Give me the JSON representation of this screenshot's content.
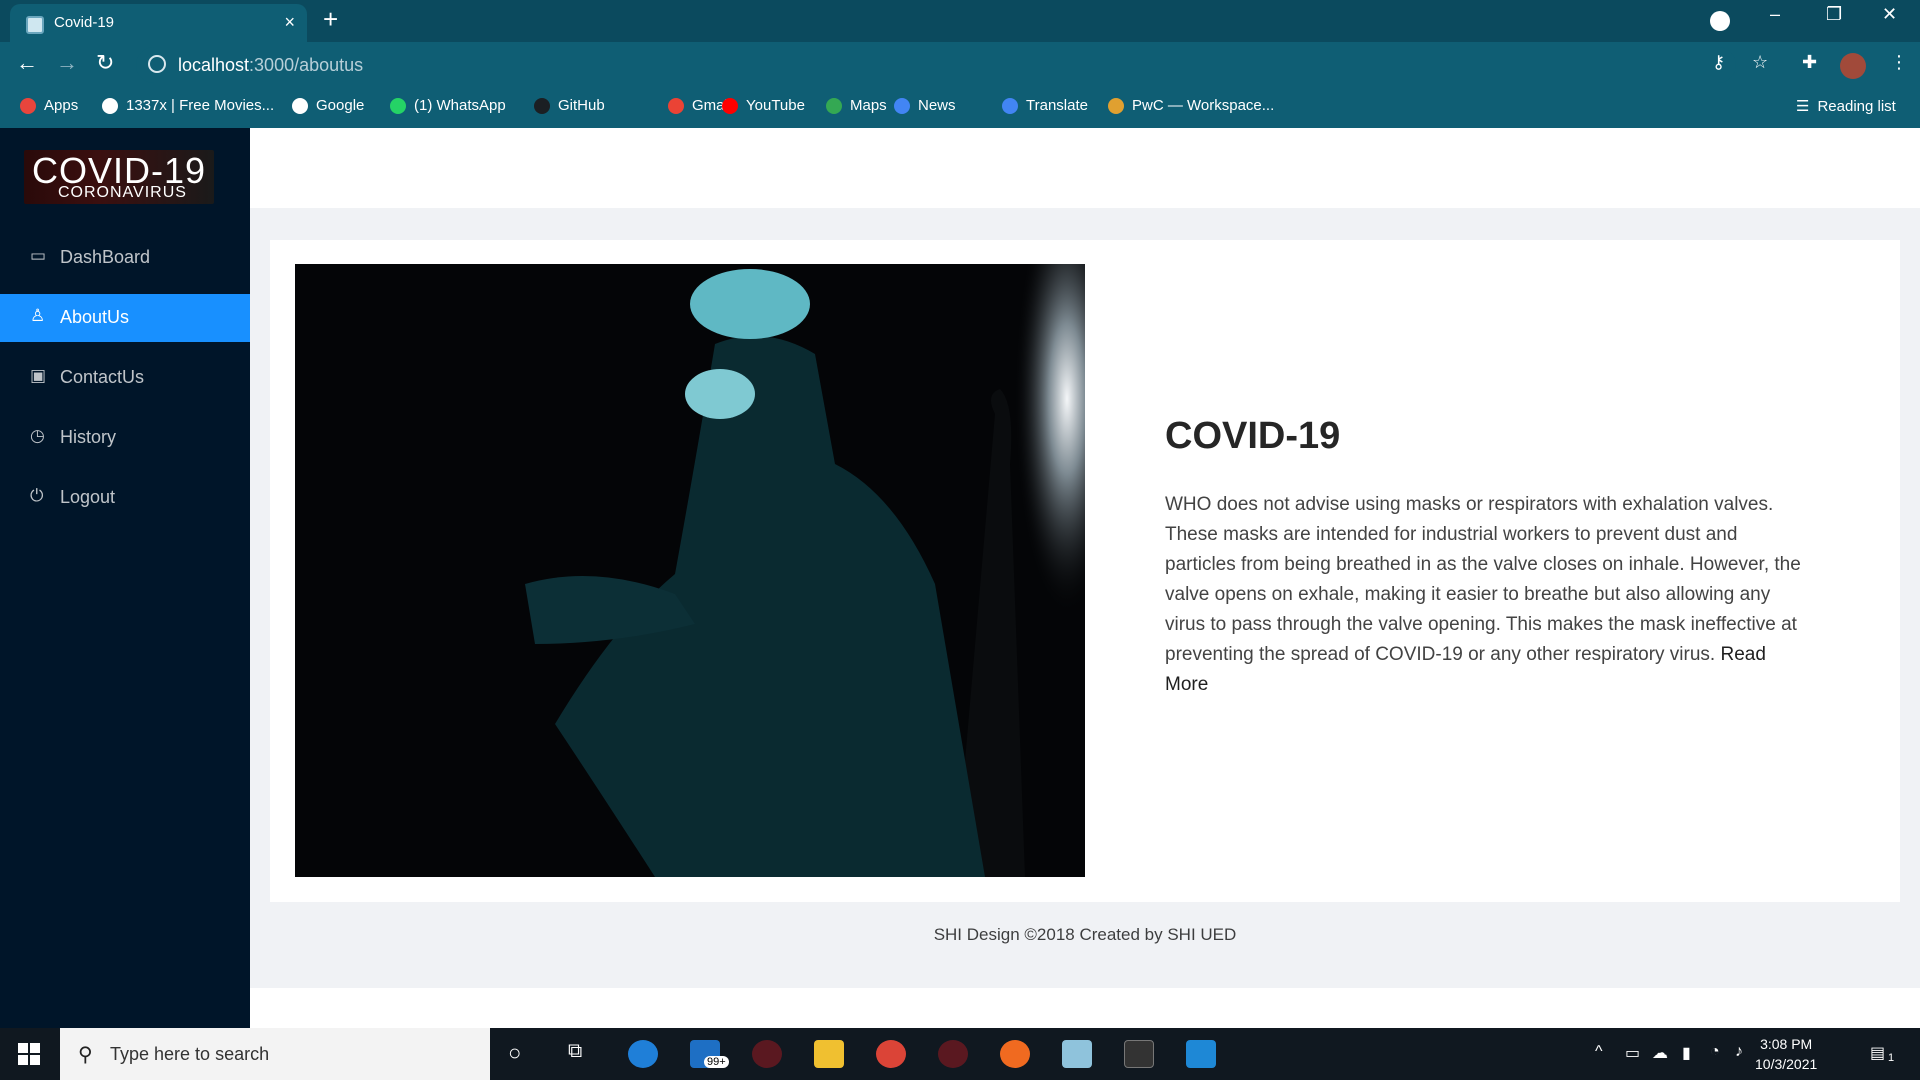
{
  "browser": {
    "tab_title": "Covid-19",
    "tab_close": "×",
    "new_tab": "+",
    "url_host": "localhost",
    "url_path": ":3000/aboutus",
    "window_controls": {
      "minimize": "–",
      "restore": "❐",
      "close": "✕"
    },
    "bookmarks": [
      {
        "label": "Apps",
        "icon": "apps-grid-icon",
        "color": "#e8453c"
      },
      {
        "label": "1337x | Free Movies...",
        "icon": "1337x-icon",
        "color": "#ffffff"
      },
      {
        "label": "Google",
        "icon": "google-icon",
        "color": "#ffffff"
      },
      {
        "label": "(1) WhatsApp",
        "icon": "whatsapp-icon",
        "color": "#25d366"
      },
      {
        "label": "GitHub",
        "icon": "github-icon",
        "color": "#1b1f23"
      },
      {
        "label": "Gmail",
        "icon": "gmail-icon",
        "color": "#ea4335"
      },
      {
        "label": "YouTube",
        "icon": "youtube-icon",
        "color": "#ff0000"
      },
      {
        "label": "Maps",
        "icon": "maps-icon",
        "color": "#34a853"
      },
      {
        "label": "News",
        "icon": "news-icon",
        "color": "#4285f4"
      },
      {
        "label": "Translate",
        "icon": "translate-icon",
        "color": "#4285f4"
      },
      {
        "label": "PwC — Workspace...",
        "icon": "pwc-icon",
        "color": "#e0a030"
      }
    ],
    "reading_list": "Reading list"
  },
  "sidebar": {
    "logo_title": "COVID-19",
    "logo_subtitle": "CORONAVIRUS",
    "items": [
      {
        "label": "DashBoard",
        "icon": "desktop-icon",
        "active": false
      },
      {
        "label": "AboutUs",
        "icon": "user-icon",
        "active": true
      },
      {
        "label": "ContactUs",
        "icon": "contacts-icon",
        "active": false
      },
      {
        "label": "History",
        "icon": "history-icon",
        "active": false
      },
      {
        "label": "Logout",
        "icon": "logout-icon",
        "active": false
      }
    ]
  },
  "main": {
    "title": "COVID-19",
    "body": "WHO does not advise using masks or respirators with exhalation valves. These masks are intended for industrial workers to prevent dust and particles from being breathed in as the valve closes on inhale. However, the valve opens on exhale, making it easier to breathe but also allowing any virus to pass through the valve opening. This makes the mask ineffective at preventing the spread of COVID-19 or any other respiratory virus.",
    "read_more": "Read More",
    "accent": "#1890ff"
  },
  "footer": {
    "text": "SHI Design ©2018 Created by SHI UED"
  },
  "taskbar": {
    "search_placeholder": "Type here to search",
    "mail_badge": "99+",
    "time": "3:08 PM",
    "date": "10/3/2021",
    "notification_count": "1"
  }
}
